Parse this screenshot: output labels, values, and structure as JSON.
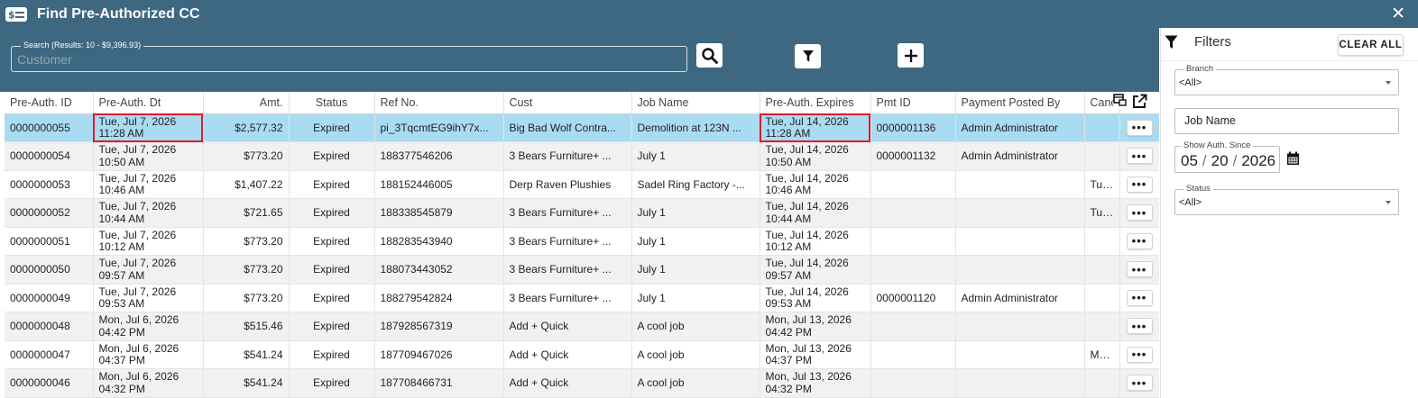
{
  "window": {
    "title": "Find Pre-Authorized CC",
    "close_glyph": "✕"
  },
  "search": {
    "legend": "Search (Results: 10 - $9,396.93)",
    "placeholder": "Customer",
    "value": ""
  },
  "toolbar": {
    "search_icon": "search-icon",
    "filter_icon": "filter-icon",
    "add_icon": "plus-icon"
  },
  "table": {
    "columns": [
      "Pre-Auth. ID",
      "Pre-Auth. Dt",
      "Amt.",
      "Status",
      "Ref No.",
      "Cust",
      "Job Name",
      "Pre-Auth. Expires",
      "Pmt ID",
      "Payment Posted By",
      "Canc"
    ],
    "selected_row": 0,
    "row_action_label": "•••",
    "rows": [
      {
        "id": "0000000055",
        "dt1": "Tue, Jul 7, 2026",
        "dt2": "11:28 AM",
        "amt": "$2,577.32",
        "status": "Expired",
        "ref": "pi_3TqcmtEG9ihY7x...",
        "cust": "Big Bad Wolf Contra...",
        "job": "Demolition at 123N ...",
        "exp1": "Tue, Jul 14, 2026",
        "exp2": "11:28 AM",
        "pmt": "0000001136",
        "postedby": "Admin Administrator",
        "canc": ""
      },
      {
        "id": "0000000054",
        "dt1": "Tue, Jul 7, 2026",
        "dt2": "10:50 AM",
        "amt": "$773.20",
        "status": "Expired",
        "ref": "188377546206",
        "cust": "3 Bears Furniture+ ...",
        "job": "July 1",
        "exp1": "Tue, Jul 14, 2026",
        "exp2": "10:50 AM",
        "pmt": "0000001132",
        "postedby": "Admin Administrator",
        "canc": ""
      },
      {
        "id": "0000000053",
        "dt1": "Tue, Jul 7, 2026",
        "dt2": "10:46 AM",
        "amt": "$1,407.22",
        "status": "Expired",
        "ref": "188152446005",
        "cust": "Derp Raven Plushies",
        "job": "Sadel Ring Factory -...",
        "exp1": "Tue, Jul 14, 2026",
        "exp2": "10:46 AM",
        "pmt": "",
        "postedby": "",
        "canc": "Tue, J"
      },
      {
        "id": "0000000052",
        "dt1": "Tue, Jul 7, 2026",
        "dt2": "10:44 AM",
        "amt": "$721.65",
        "status": "Expired",
        "ref": "188338545879",
        "cust": "3 Bears Furniture+ ...",
        "job": "July 1",
        "exp1": "Tue, Jul 14, 2026",
        "exp2": "10:44 AM",
        "pmt": "",
        "postedby": "",
        "canc": "Tue, J"
      },
      {
        "id": "0000000051",
        "dt1": "Tue, Jul 7, 2026",
        "dt2": "10:12 AM",
        "amt": "$773.20",
        "status": "Expired",
        "ref": "188283543940",
        "cust": "3 Bears Furniture+ ...",
        "job": "July 1",
        "exp1": "Tue, Jul 14, 2026",
        "exp2": "10:12 AM",
        "pmt": "",
        "postedby": "",
        "canc": ""
      },
      {
        "id": "0000000050",
        "dt1": "Tue, Jul 7, 2026",
        "dt2": "09:57 AM",
        "amt": "$773.20",
        "status": "Expired",
        "ref": "188073443052",
        "cust": "3 Bears Furniture+ ...",
        "job": "July 1",
        "exp1": "Tue, Jul 14, 2026",
        "exp2": "09:57 AM",
        "pmt": "",
        "postedby": "",
        "canc": ""
      },
      {
        "id": "0000000049",
        "dt1": "Tue, Jul 7, 2026",
        "dt2": "09:53 AM",
        "amt": "$773.20",
        "status": "Expired",
        "ref": "188279542824",
        "cust": "3 Bears Furniture+ ...",
        "job": "July 1",
        "exp1": "Tue, Jul 14, 2026",
        "exp2": "09:53 AM",
        "pmt": "0000001120",
        "postedby": "Admin Administrator",
        "canc": ""
      },
      {
        "id": "0000000048",
        "dt1": "Mon, Jul 6, 2026",
        "dt2": "04:42 PM",
        "amt": "$515.46",
        "status": "Expired",
        "ref": "187928567319",
        "cust": "Add + Quick",
        "job": "A cool job",
        "exp1": "Mon, Jul 13, 2026",
        "exp2": "04:42 PM",
        "pmt": "",
        "postedby": "",
        "canc": ""
      },
      {
        "id": "0000000047",
        "dt1": "Mon, Jul 6, 2026",
        "dt2": "04:37 PM",
        "amt": "$541.24",
        "status": "Expired",
        "ref": "187709467026",
        "cust": "Add + Quick",
        "job": "A cool job",
        "exp1": "Mon, Jul 13, 2026",
        "exp2": "04:37 PM",
        "pmt": "",
        "postedby": "",
        "canc": "Mon,"
      },
      {
        "id": "0000000046",
        "dt1": "Mon, Jul 6, 2026",
        "dt2": "04:32 PM",
        "amt": "$541.24",
        "status": "Expired",
        "ref": "187708466731",
        "cust": "Add + Quick",
        "job": "A cool job",
        "exp1": "Mon, Jul 13, 2026",
        "exp2": "04:32 PM",
        "pmt": "",
        "postedby": "",
        "canc": ""
      }
    ]
  },
  "filters": {
    "title": "Filters",
    "clear_all": "CLEAR ALL",
    "branch": {
      "legend": "Branch",
      "value": "<All>"
    },
    "job_name": {
      "placeholder": "Job Name",
      "value": ""
    },
    "show_auth_since": {
      "legend": "Show Auth. Since",
      "month": "05",
      "day": "20",
      "year": "2026"
    },
    "status": {
      "legend": "Status",
      "value": "<All>"
    }
  },
  "colors": {
    "header_bg": "#3e6882",
    "selected_row": "#a9dcf3",
    "stripe": "#f1f1f1",
    "highlight_box": "#e0182c"
  }
}
